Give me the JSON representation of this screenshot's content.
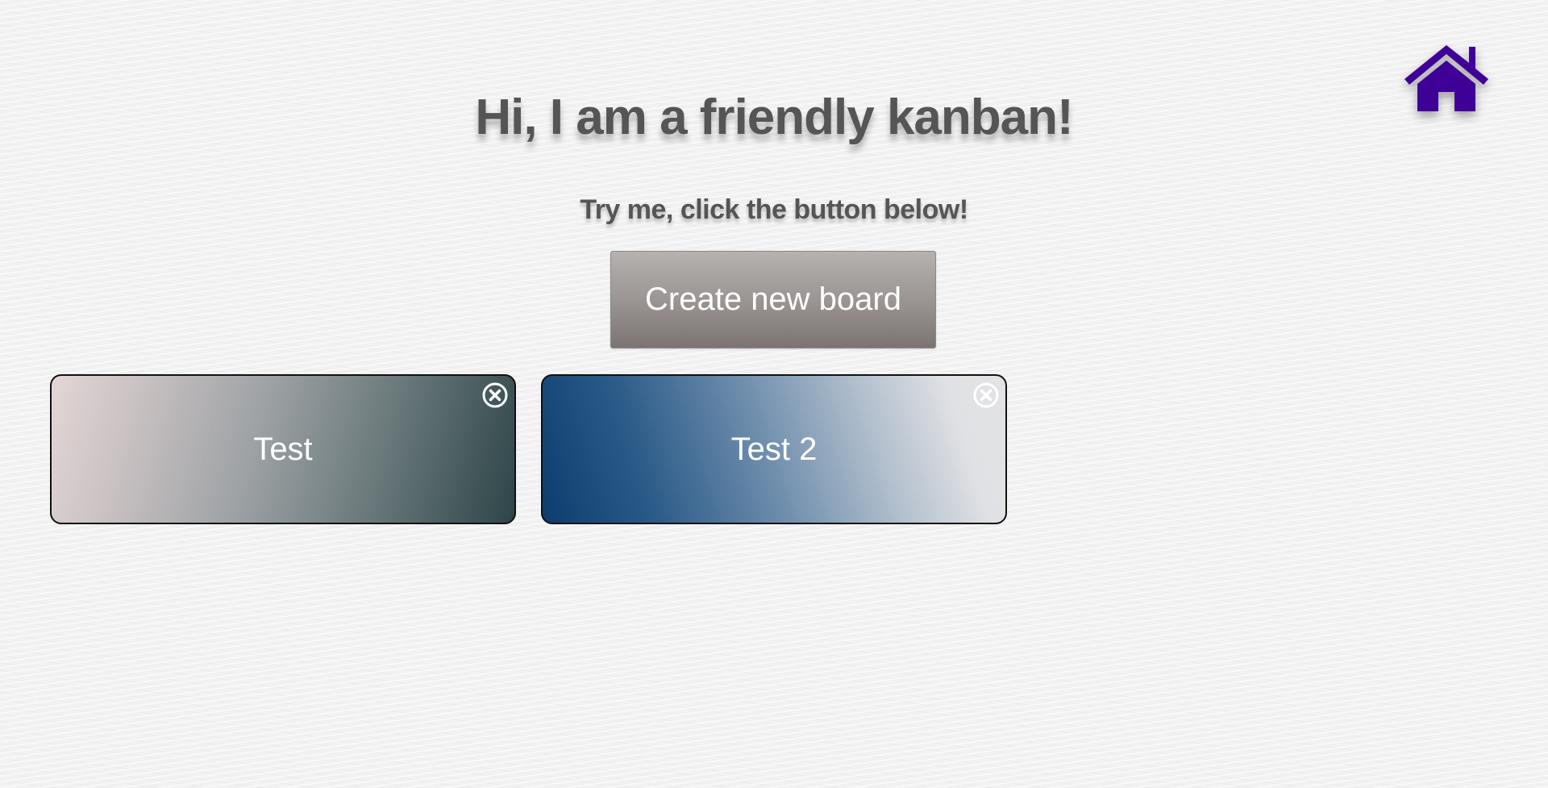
{
  "header": {
    "home_icon": "home-icon",
    "title": "Hi, I am a friendly kanban!",
    "subtitle": "Try me, click the button below!",
    "create_button_label": "Create new board"
  },
  "colors": {
    "home_icon": "#3f0098",
    "title_text": "#555555",
    "button_top": "#b5b2af",
    "button_bottom": "#7b7473"
  },
  "boards": [
    {
      "name": "Test",
      "remove_icon": "close-circle-icon"
    },
    {
      "name": "Test 2",
      "remove_icon": "close-circle-icon"
    }
  ]
}
